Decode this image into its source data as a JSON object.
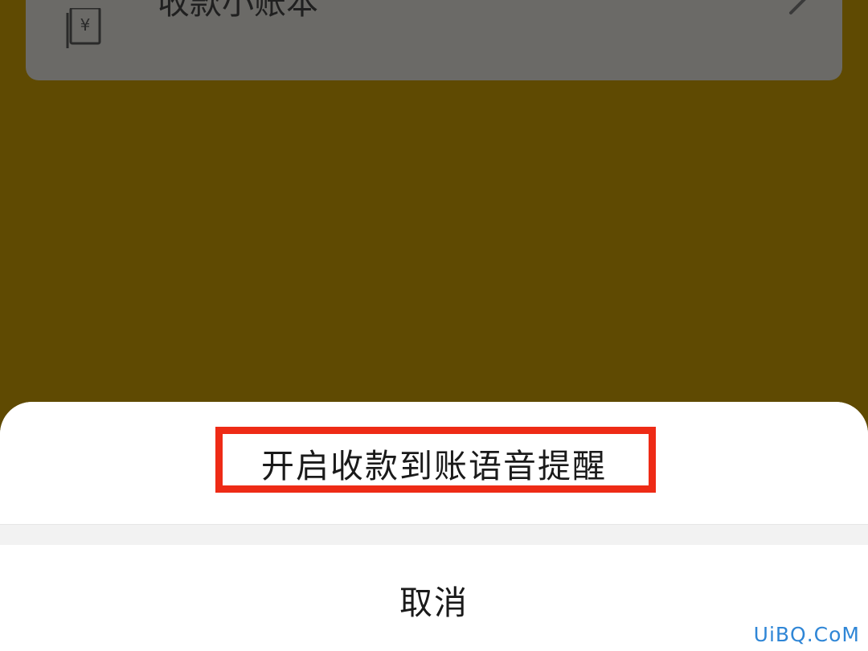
{
  "background_card": {
    "label": "收款小账本",
    "icon": "ledger-icon",
    "chevron": "chevron-right-icon"
  },
  "action_sheet": {
    "option_label": "开启收款到账语音提醒",
    "cancel_label": "取消"
  },
  "watermark": {
    "text": "UiBQ.CoM"
  },
  "colors": {
    "overlay_background": "#5f4a02",
    "card_dimmed": "#6b6a67",
    "highlight_border": "#ee2b16",
    "watermark": "#2f86d6"
  }
}
